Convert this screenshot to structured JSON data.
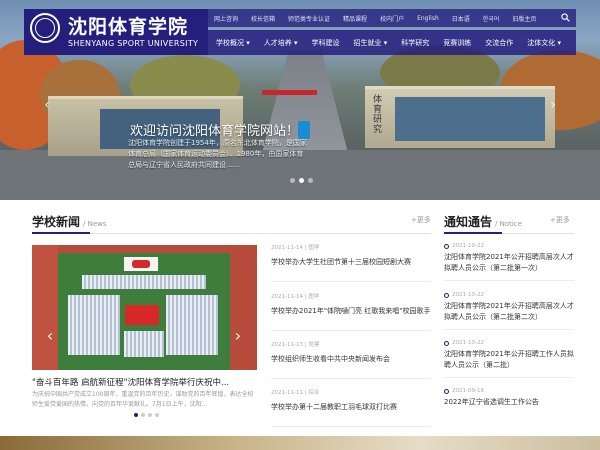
{
  "header": {
    "logo_cn": "沈阳体育学院",
    "logo_en": "SHENYANG SPORT UNIVERSITY",
    "top_links": [
      "网上咨询",
      "校长信箱",
      "师范类专业认证",
      "精品课程",
      "校内门户",
      "English",
      "日本语",
      "한국어",
      "旧版主页"
    ],
    "main_nav": [
      "学校概况 ▾",
      "人才培养 ▾",
      "学科建设",
      "招生就业 ▾",
      "科学研究",
      "竞赛训练",
      "交流合作",
      "沈体文化 ▾"
    ]
  },
  "hero": {
    "caption": "欢迎访问沈阳体育学院网站！",
    "desc": "沈阳体育学院创建于1954年，原名东北体育学院，是国家体育总局（国家体育运动委员会）、1980年，由国家体育总局与辽宁省人民政府共同建设……",
    "building_sign": "体育研究"
  },
  "news": {
    "title": "学校新闻",
    "subtitle": "/ News",
    "more": "+更多",
    "featured_title": "\"奋斗百年路 启航新征程\"沈阳体育学院举行庆祝中...",
    "featured_desc": "为庆祝中国共产党成立100周年，重温党的百年历史，谋助党的百年辉煌，表达全校师生爱党爱国的热情，向党的百年华诞献礼。7月1日上午，沈阳...",
    "items": [
      {
        "date": "2021-11-14",
        "tag": "图学",
        "title": "学校举办大学生社团节第十三届校园短剧大赛"
      },
      {
        "date": "2021-11-14",
        "tag": "图学",
        "title": "学校举办2021年\"体院嗵门亮 红歌我来唱\"校园歌手大赛"
      },
      {
        "date": "2021-11-13",
        "tag": "党建",
        "title": "学校组织师生收看中共中央新闻发布会"
      },
      {
        "date": "2021-11-11",
        "tag": "综合",
        "title": "学校举办第十二届教职工羽毛球双打比赛"
      }
    ]
  },
  "notice": {
    "title": "通知通告",
    "subtitle": "/ Notice",
    "more": "+更多",
    "items": [
      {
        "date": "2021-10-22",
        "title": "沈阳体育学院2021年公开招聘高层次人才拟聘人员公示（第二批第一次）"
      },
      {
        "date": "2021-10-22",
        "title": "沈阳体育学院2021年公开招聘高层次人才拟聘人员公示（第二批第二次）"
      },
      {
        "date": "2021-10-22",
        "title": "沈阳体育学院2021年公开招聘工作人员拟聘人员公示（第二批）"
      },
      {
        "date": "2021-09-18",
        "title": "2022年辽宁省选调生工作公告"
      }
    ]
  },
  "colors": {
    "brand": "#241e7c"
  }
}
